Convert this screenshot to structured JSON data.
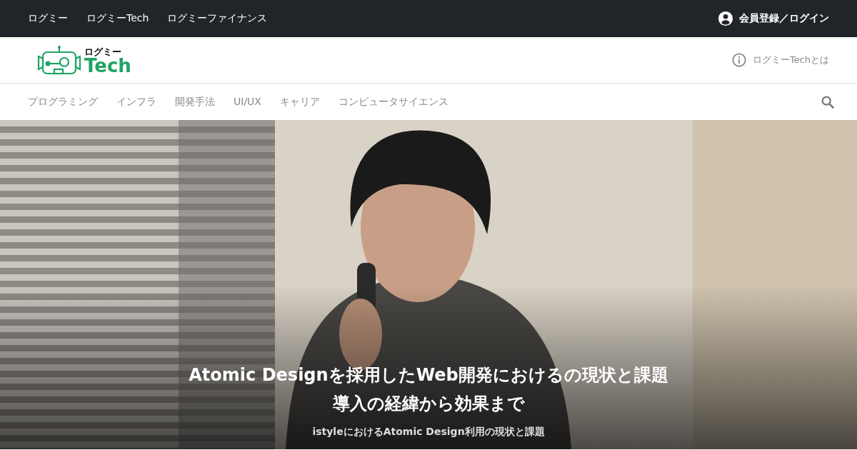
{
  "top_bar": {
    "links": [
      "ログミー",
      "ログミーTech",
      "ログミーファイナンス"
    ],
    "account": "会員登録／ログイン"
  },
  "header": {
    "logo": {
      "small": "ログミー",
      "large": "Tech"
    },
    "about": "ログミーTechとは"
  },
  "categories": [
    "プログラミング",
    "インフラ",
    "開発手法",
    "UI/UX",
    "キャリア",
    "コンピュータサイエンス"
  ],
  "hero": {
    "title_lines": [
      "Atomic Designを採用したWeb開発におけるの現状と課題",
      "導入の経緯から効果まで"
    ],
    "subtitle": "istyleにおけるAtomic Design利用の現状と課題"
  }
}
